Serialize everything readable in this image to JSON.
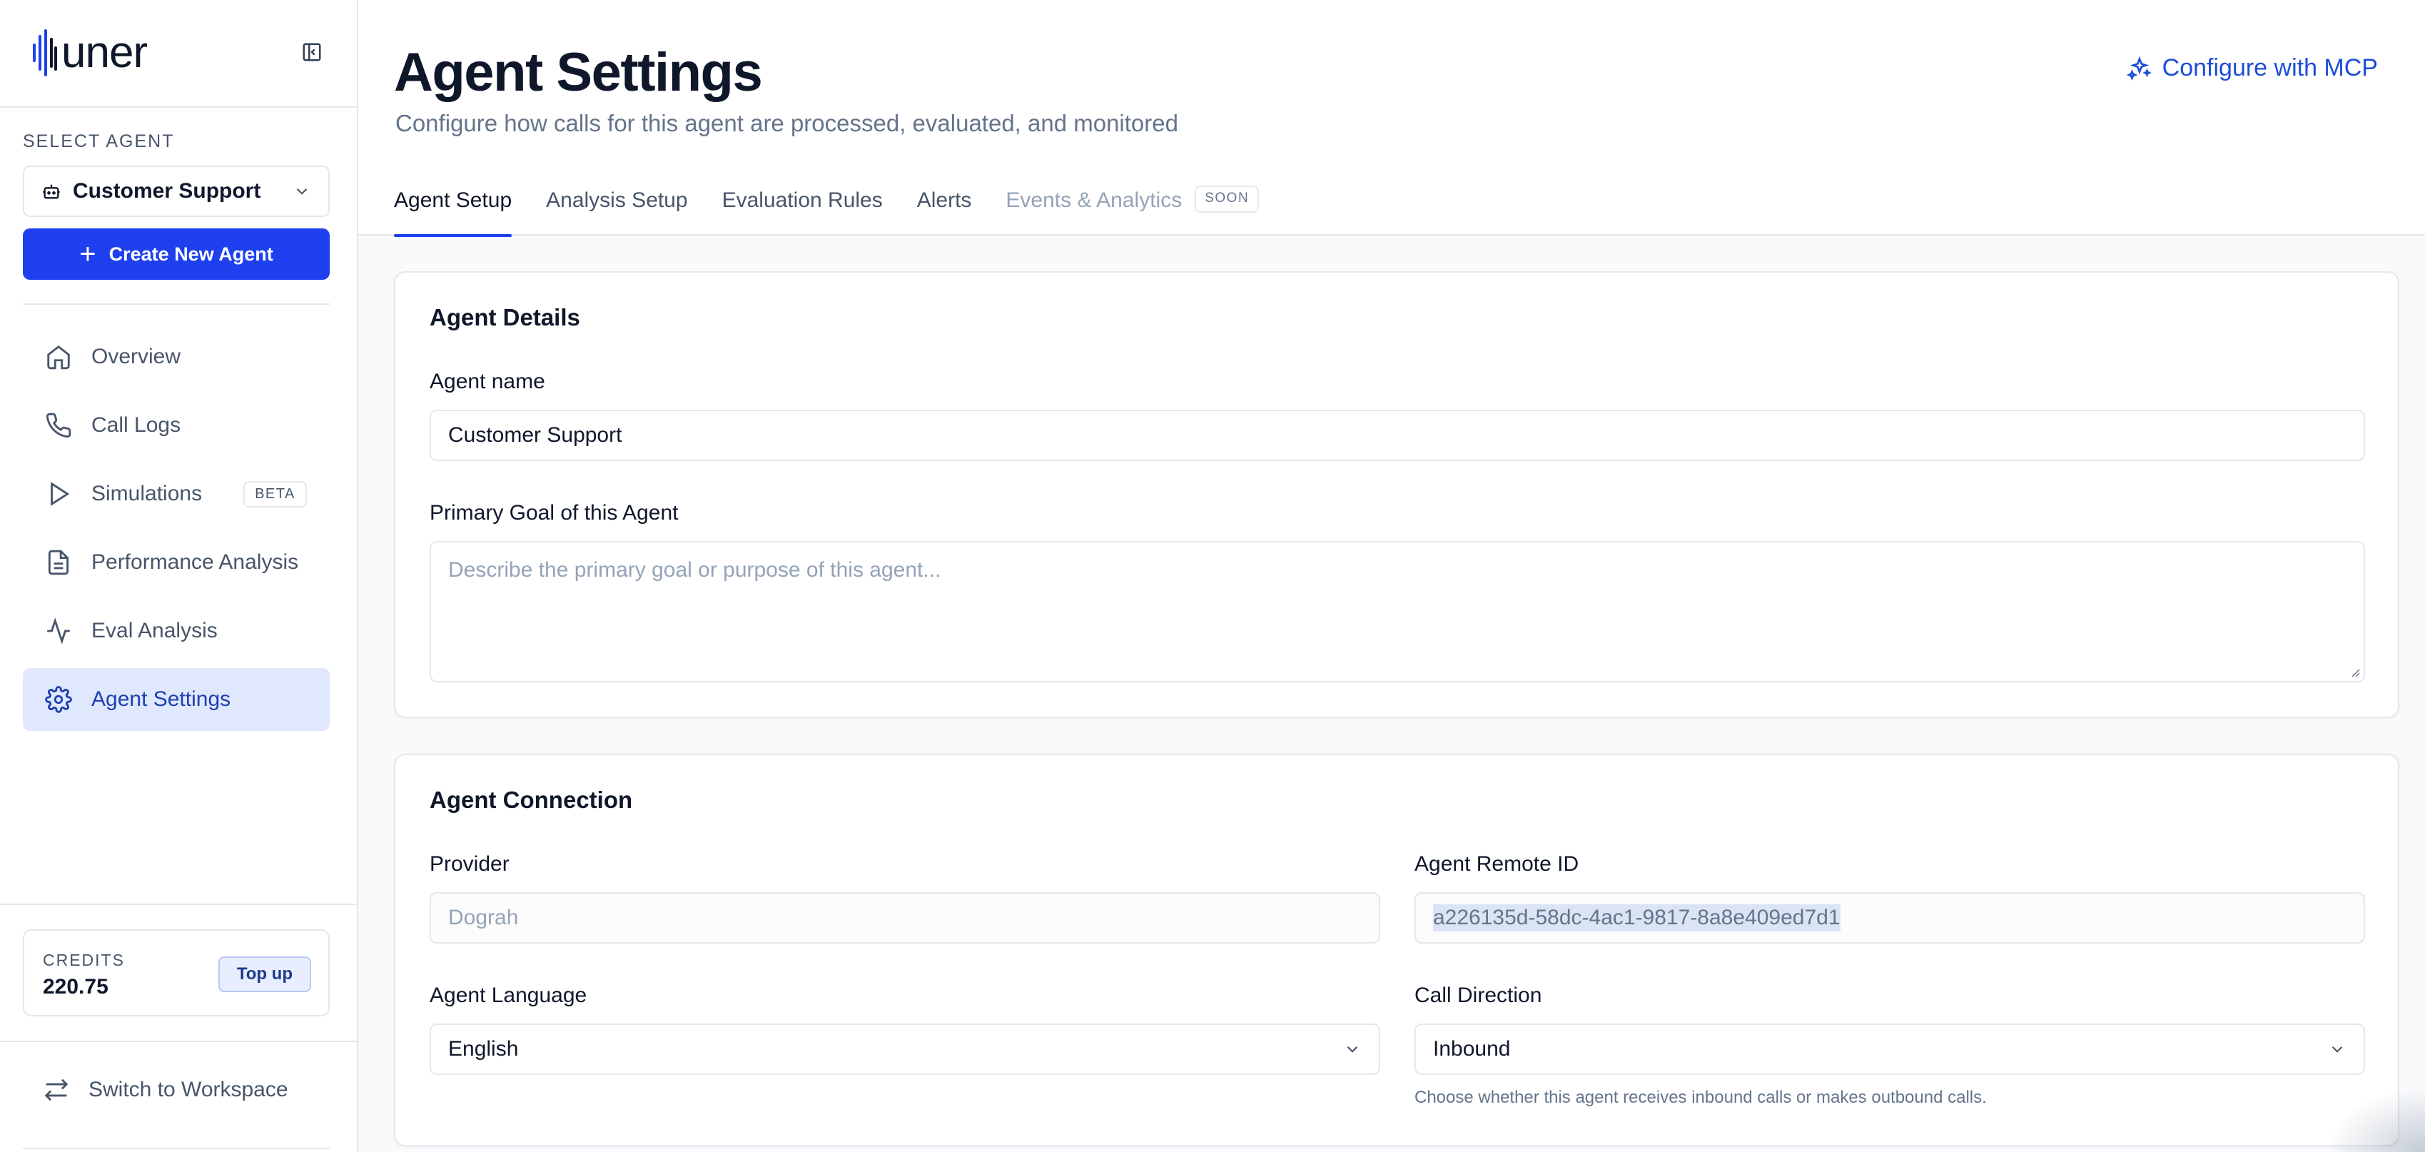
{
  "brand": {
    "logo_text": "uner",
    "accent": "#1e40ef"
  },
  "sidebar": {
    "select_agent_label": "SELECT AGENT",
    "selected_agent": "Customer Support",
    "create_button": "Create New Agent",
    "items": [
      {
        "label": "Overview",
        "icon": "home-icon"
      },
      {
        "label": "Call Logs",
        "icon": "phone-icon"
      },
      {
        "label": "Simulations",
        "icon": "play-icon",
        "badge": "BETA"
      },
      {
        "label": "Performance Analysis",
        "icon": "document-icon"
      },
      {
        "label": "Eval Analysis",
        "icon": "activity-icon"
      },
      {
        "label": "Agent Settings",
        "icon": "gear-icon",
        "active": true
      }
    ],
    "credits": {
      "label": "CREDITS",
      "value": "220.75",
      "topup": "Top up"
    },
    "switch_label": "Switch to Workspace"
  },
  "header": {
    "title": "Agent Settings",
    "subtitle": "Configure how calls for this agent are processed, evaluated, and monitored",
    "mcp_button": "Configure with MCP",
    "tabs": [
      {
        "label": "Agent Setup",
        "active": true
      },
      {
        "label": "Analysis Setup"
      },
      {
        "label": "Evaluation Rules"
      },
      {
        "label": "Alerts"
      },
      {
        "label": "Events & Analytics",
        "disabled": true,
        "badge": "SOON"
      }
    ]
  },
  "agent_details": {
    "title": "Agent Details",
    "name_label": "Agent name",
    "name_value": "Customer Support",
    "goal_label": "Primary Goal of this Agent",
    "goal_placeholder": "Describe the primary goal or purpose of this agent..."
  },
  "agent_connection": {
    "title": "Agent Connection",
    "provider_label": "Provider",
    "provider_value": "Dograh",
    "remote_id_label": "Agent Remote ID",
    "remote_id_value": "a226135d-58dc-4ac1-9817-8a8e409ed7d1",
    "language_label": "Agent Language",
    "language_value": "English",
    "direction_label": "Call Direction",
    "direction_value": "Inbound",
    "direction_helper": "Choose whether this agent receives inbound calls or makes outbound calls."
  }
}
